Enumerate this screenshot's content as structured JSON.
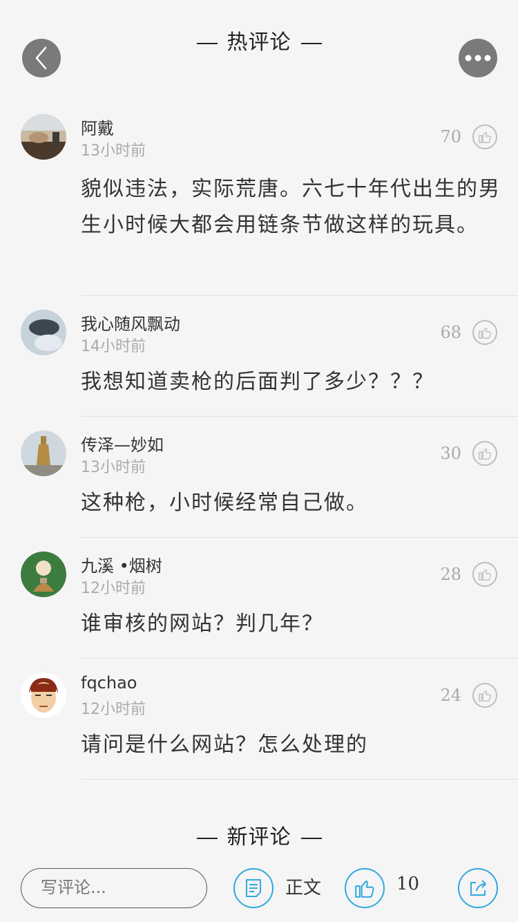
{
  "header": {
    "hot_title": "热评论",
    "new_title": "新评论"
  },
  "comments": [
    {
      "username": "阿戴",
      "time": "13小时前",
      "likes": "70",
      "text": "貌似违法，实际荒唐。六七十年代出生的男生小时候大都会用链条节做这样的玩具。"
    },
    {
      "username": "我心随风飘动",
      "time": "14小时前",
      "likes": "68",
      "text": "我想知道卖枪的后面判了多少？？？"
    },
    {
      "username": "传泽—妙如",
      "time": "13小时前",
      "likes": "30",
      "text": "这种枪，小时候经常自己做。"
    },
    {
      "username": "九溪 •烟树",
      "time": "12小时前",
      "likes": "28",
      "text": "谁审核的网站？判几年？"
    },
    {
      "username": "fqchao",
      "time": "12小时前",
      "likes": "24",
      "text": "请问是什么网站？怎么处理的"
    }
  ],
  "bottom_bar": {
    "input_placeholder": "写评论...",
    "article_label": "正文",
    "like_count": "10"
  },
  "colors": {
    "accent": "#2fa8dd",
    "background": "#f5f5f5",
    "button_gray": "#7a7a7a"
  }
}
